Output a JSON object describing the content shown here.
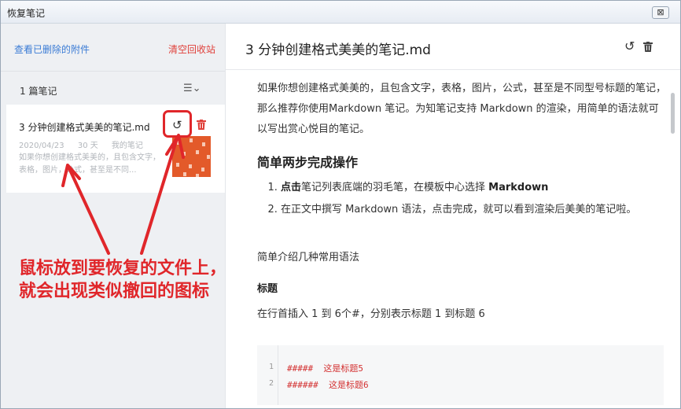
{
  "window": {
    "title": "恢复笔记",
    "close_label": "⊠"
  },
  "sidebar": {
    "view_deleted_attachments": "查看已删除的附件",
    "empty_trash": "清空回收站",
    "count_label": "1 篇笔记",
    "sort_icon": "☰⌄",
    "note": {
      "title": "3 分钟创建格式美美的笔记.md",
      "restore_icon": "↺",
      "date": "2020/04/23",
      "days": "30 天",
      "folder": "我的笔记",
      "preview": "如果你想创建格式美美的，且包含文字，表格，图片，公式，甚至是不同..."
    }
  },
  "annotation": {
    "text": "鼠标放到要恢复的文件上，就会出现类似撤回的图标"
  },
  "main": {
    "title": "3 分钟创建格式美美的笔记.md",
    "restore_icon": "↺",
    "intro": "如果你想创建格式美美的，且包含文字，表格，图片，公式，甚至是不同型号标题的笔记，那么推荐你使用Markdown 笔记。为知笔记支持 Markdown 的渲染，用简单的语法就可以写出赏心悦目的笔记。",
    "section_heading": "简单两步完成操作",
    "steps": [
      {
        "bold": "点击",
        "text": "笔记列表底端的羽毛笔，在模板中心选择 ",
        "bold2": "Markdown"
      },
      {
        "text": "在正文中撰写 Markdown 语法，点击完成，就可以看到渲染后美美的笔记啦。"
      }
    ],
    "intro2": "简单介绍几种常用语法",
    "sub_heading": "标题",
    "heading_desc": "在行首插入 1 到 6个#，分别表示标题 1 到标题 6",
    "code_lines": [
      {
        "num": "1",
        "text": "#####  这是标题5"
      },
      {
        "num": "2",
        "text": "######  这是标题6"
      }
    ]
  },
  "colors": {
    "accent_link": "#3a7bd5",
    "danger": "#e0403a",
    "annotation": "#e0262a",
    "code_text": "#d33030"
  }
}
